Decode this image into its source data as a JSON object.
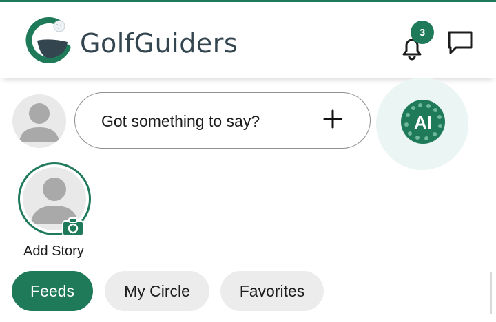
{
  "header": {
    "brand_name": "GolfGuiders",
    "logo_icon": "golfguiders-logo",
    "notification_count": "3",
    "accent_color": "#1f7a5a"
  },
  "composer": {
    "placeholder": "Got something to say?",
    "add_icon": "plus-icon",
    "ai_label": "AI"
  },
  "stories": {
    "add_label": "Add Story"
  },
  "tabs": [
    {
      "label": "Feeds",
      "active": true
    },
    {
      "label": "My Circle",
      "active": false
    },
    {
      "label": "Favorites",
      "active": false
    }
  ]
}
